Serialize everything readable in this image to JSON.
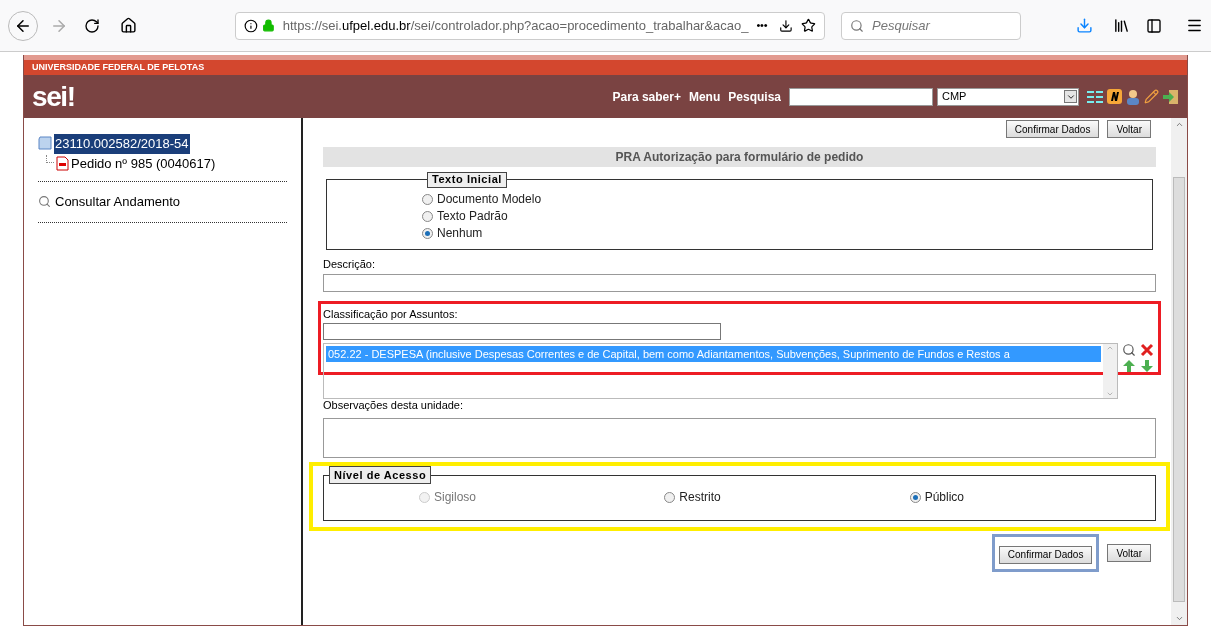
{
  "browser": {
    "url_prefix": "https://sei.",
    "url_domain": "ufpel.edu.br",
    "url_rest": "/sei/controlador.php?acao=procedimento_trabalhar&acao_",
    "more": "•••",
    "search_placeholder": "Pesquisar"
  },
  "header": {
    "institution": "UNIVERSIDADE FEDERAL DE PELOTAS",
    "logo": "sei!",
    "links": [
      "Para saber+",
      "Menu",
      "Pesquisa"
    ],
    "unit": "CMP"
  },
  "tree": {
    "process": "23110.002582/2018-54",
    "selected": true,
    "children": [
      {
        "label": "Pedido nº 985 (0040617)"
      }
    ]
  },
  "sidebar_links": [
    "Consultar Andamento"
  ],
  "form": {
    "top_buttons": [
      "Confirmar Dados",
      "Voltar"
    ],
    "title": "PRA Autorização para formulário de pedido",
    "texto_inicial": {
      "legend": "Texto Inicial",
      "options": [
        {
          "label": "Documento Modelo",
          "selected": false,
          "disabled": false
        },
        {
          "label": "Texto Padrão",
          "selected": false,
          "disabled": false
        },
        {
          "label": "Nenhum",
          "selected": true,
          "disabled": false
        }
      ]
    },
    "descricao_label": "Descrição:",
    "classificacao_label": "Classificação por Assuntos:",
    "classificacao_items": [
      {
        "text": "052.22 - DESPESA (inclusive Despesas Correntes e de Capital, bem como Adiantamentos, Subvenções, Suprimento de Fundos e Restos a",
        "selected": true
      }
    ],
    "observacoes_label": "Observações desta unidade:",
    "nivel_acesso": {
      "legend": "Nível de Acesso",
      "options": [
        {
          "label": "Sigiloso",
          "selected": false,
          "disabled": true
        },
        {
          "label": "Restrito",
          "selected": false,
          "disabled": false
        },
        {
          "label": "Público",
          "selected": true,
          "disabled": false
        }
      ]
    },
    "bottom_buttons": [
      "Confirmar Dados",
      "Voltar"
    ]
  }
}
